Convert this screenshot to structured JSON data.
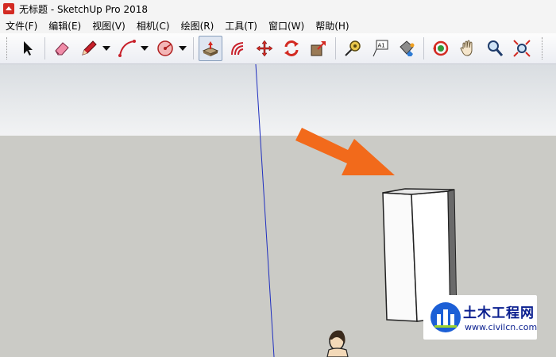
{
  "window": {
    "title": "无标题 - SketchUp Pro 2018"
  },
  "menu": [
    "文件(F)",
    "编辑(E)",
    "视图(V)",
    "相机(C)",
    "绘图(R)",
    "工具(T)",
    "窗口(W)",
    "帮助(H)"
  ],
  "toolbar": {
    "tools": [
      {
        "name": "select-tool",
        "icon": "arrow-cursor-icon"
      },
      {
        "name": "eraser-tool",
        "icon": "eraser-icon"
      },
      {
        "name": "pencil-tool",
        "icon": "pencil-icon",
        "dropdown": true
      },
      {
        "name": "arc-tool",
        "icon": "arc-icon",
        "dropdown": true
      },
      {
        "name": "polygon-tool",
        "icon": "polygon-icon",
        "dropdown": true
      },
      {
        "name": "push-pull-tool",
        "icon": "push-pull-icon",
        "active": true
      },
      {
        "name": "offset-tool",
        "icon": "offset-icon"
      },
      {
        "name": "move-tool",
        "icon": "move-icon"
      },
      {
        "name": "rotate-tool",
        "icon": "rotate-icon"
      },
      {
        "name": "scale-tool",
        "icon": "scale-icon"
      },
      {
        "name": "tape-measure-tool",
        "icon": "tape-measure-icon"
      },
      {
        "name": "text-tool",
        "icon": "text-icon",
        "text": "A1"
      },
      {
        "name": "paint-bucket-tool",
        "icon": "paint-bucket-icon"
      },
      {
        "name": "orbit-tool",
        "icon": "orbit-icon"
      },
      {
        "name": "pan-tool",
        "icon": "hand-icon"
      },
      {
        "name": "zoom-tool",
        "icon": "magnifier-icon"
      },
      {
        "name": "zoom-extents-tool",
        "icon": "zoom-extents-icon"
      }
    ]
  },
  "watermark": {
    "name": "土木工程网",
    "url": "www.civilcn.com"
  },
  "colors": {
    "sky": "#e4e6e8",
    "ground": "#cbcbc6",
    "arrow": "#f26a1b",
    "axis_blue": "#2030c0"
  }
}
